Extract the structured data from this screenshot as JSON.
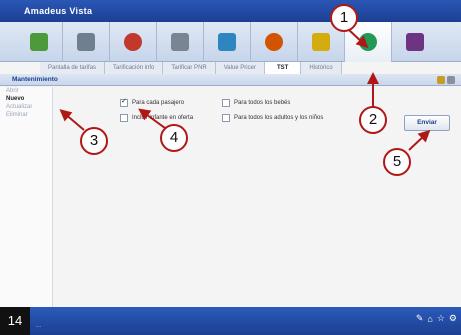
{
  "app": {
    "title": "Amadeus Vista"
  },
  "toolbar": {
    "buttons": [
      {
        "name": "cube-icon",
        "color": "#4c9a3a"
      },
      {
        "name": "grid-icon",
        "color": "#6f7f8f"
      },
      {
        "name": "person-icon",
        "color": "#c0392b"
      },
      {
        "name": "car-icon",
        "color": "#7a8594"
      },
      {
        "name": "car2-icon",
        "color": "#2e86c1"
      },
      {
        "name": "traveler-icon",
        "color": "#d35400"
      },
      {
        "name": "plane-icon",
        "color": "#d4ac0d"
      },
      {
        "name": "pricing-icon",
        "color": "#229954"
      },
      {
        "name": "chart-icon",
        "color": "#6c3483"
      }
    ]
  },
  "subtabs": [
    "Pantalla de tarifas",
    "Tarificación info",
    "Tarificar PNR",
    "Value Pricer",
    "TST",
    "Histórico"
  ],
  "section": {
    "title": "Mantenimiento"
  },
  "sidebar": {
    "items": [
      "Abrir",
      "Nuevo",
      "Actualizar",
      "Eliminar"
    ]
  },
  "options": {
    "per_passenger": "Para cada pasajero",
    "all_babies": "Para todos los bebés",
    "include_infant": "Incluir infante en oferta",
    "all_adults_children": "Para todos los adultos y los niños"
  },
  "send_label": "Enviar",
  "status": {
    "text": "...",
    "page_number": "14"
  },
  "callouts": [
    "1",
    "2",
    "3",
    "4",
    "5"
  ]
}
